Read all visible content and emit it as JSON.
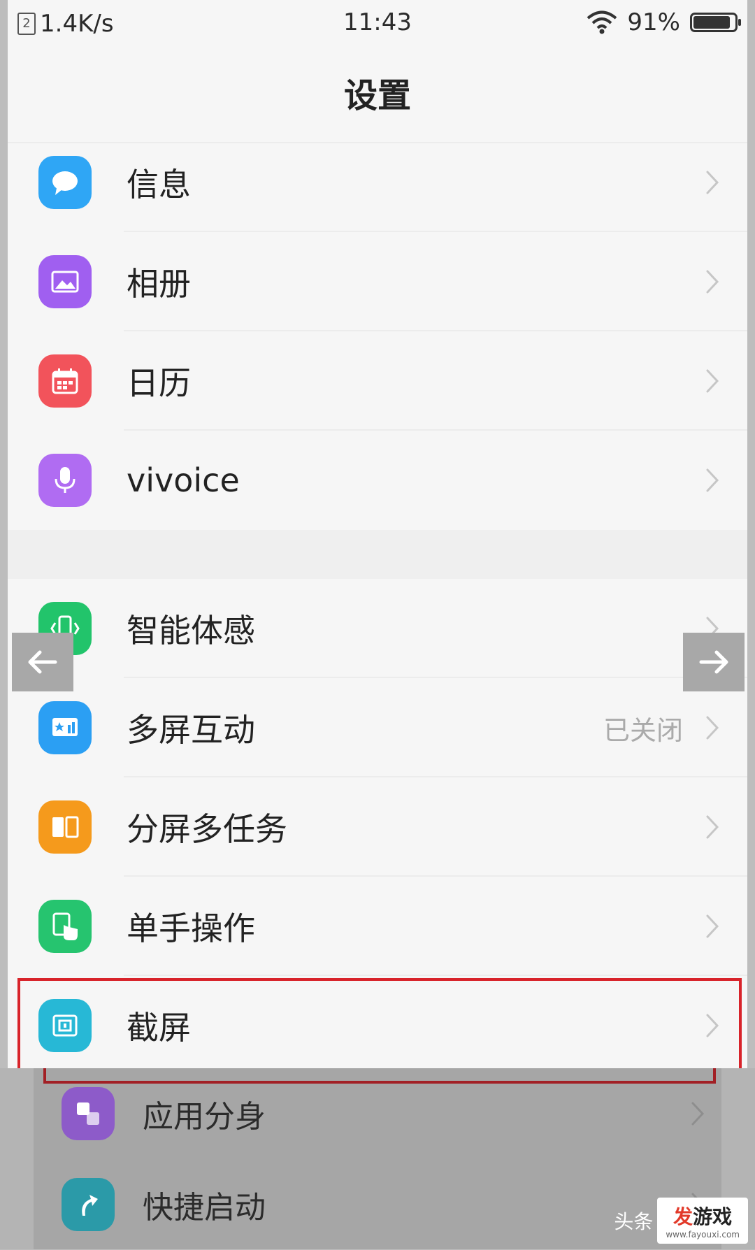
{
  "status_bar": {
    "sim_label": "2",
    "net_speed": "1.4K/s",
    "time": "11:43",
    "battery_percent": "91%",
    "battery_level": 0.91
  },
  "page_title": "设置",
  "group1": [
    {
      "label": "信息",
      "icon": "message-icon",
      "color": "#2fa6f5"
    },
    {
      "label": "相册",
      "icon": "album-icon",
      "color": "#a05ff0"
    },
    {
      "label": "日历",
      "icon": "calendar-icon",
      "color": "#f2535b"
    },
    {
      "label": "vivoice",
      "icon": "microphone-icon",
      "color": "#b06cf2"
    }
  ],
  "group2": [
    {
      "label": "智能体感",
      "icon": "motion-phone-icon",
      "color": "#22c46b",
      "value": ""
    },
    {
      "label": "多屏互动",
      "icon": "cast-screen-icon",
      "color": "#2b9ff3",
      "value": "已关闭"
    },
    {
      "label": "分屏多任务",
      "icon": "split-screen-icon",
      "color": "#f59a1c",
      "value": ""
    },
    {
      "label": "单手操作",
      "icon": "one-hand-icon",
      "color": "#26c46f",
      "value": ""
    },
    {
      "label": "截屏",
      "icon": "screenshot-icon",
      "color": "#27b8d6",
      "value": ""
    }
  ],
  "group3": [
    {
      "label": "应用分身",
      "icon": "app-clone-icon",
      "color": "#8d5bc9"
    },
    {
      "label": "快捷启动",
      "icon": "quick-launch-icon",
      "color": "#2b9aa8"
    }
  ],
  "watermark": {
    "prefix": "头条",
    "logo_main": "发",
    "logo_rest": "游戏",
    "url": "www.fayouxi.com"
  },
  "colors": {
    "highlight": "#d8232a",
    "background": "#f6f6f6"
  }
}
